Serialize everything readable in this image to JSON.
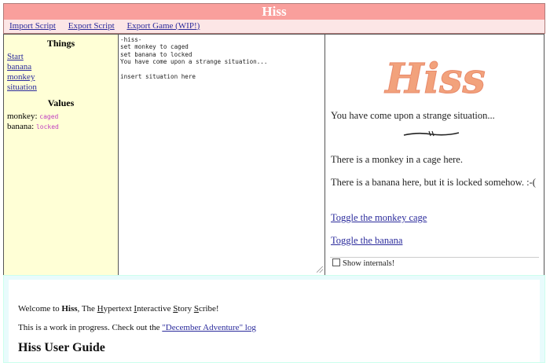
{
  "app": {
    "title": "Hiss"
  },
  "menu": {
    "import_label": "Import Script",
    "export_label": "Export Script",
    "export_game_label": "Export Game (WIP!)"
  },
  "sidebar": {
    "things_heading": "Things",
    "things": [
      "Start",
      "banana",
      "monkey",
      "situation"
    ],
    "values_heading": "Values",
    "values": [
      {
        "name": "monkey:",
        "value": "caged"
      },
      {
        "name": "banana:",
        "value": "locked"
      }
    ]
  },
  "editor": {
    "text": "-hiss-\nset monkey to caged\nset banana to locked\nYou have come upon a strange situation...\n\ninsert situation here"
  },
  "preview": {
    "logo_text": "Hiss",
    "intro": "You have come upon a strange situation...",
    "monkey_line": "There is a monkey in a cage here.",
    "banana_line": "There is a banana here, but it is locked somehow. :-(",
    "toggle_monkey": "Toggle the monkey cage",
    "toggle_banana": "Toggle the banana",
    "show_internals": "Show internals!"
  },
  "guide": {
    "welcome_prefix": "Welcome to ",
    "welcome_app": "Hiss",
    "welcome_suffix_parts": [
      ", The ",
      "H",
      "ypertext ",
      "I",
      "nteractive ",
      "S",
      "tory ",
      "S",
      "cribe!"
    ],
    "wip_prefix": "This is a work in progress. Check out the ",
    "wip_link": "\"December Adventure\" log",
    "heading": "Hiss User Guide"
  },
  "colors": {
    "banner_bg": "#f99f9c",
    "menubar_bg": "#fce6e6",
    "sidebar_bg": "#ffffd6",
    "link": "#2b2b9c",
    "value_text": "#c040c0",
    "logo": "#f2a27c",
    "guide_bg": "#e8fbfc"
  }
}
